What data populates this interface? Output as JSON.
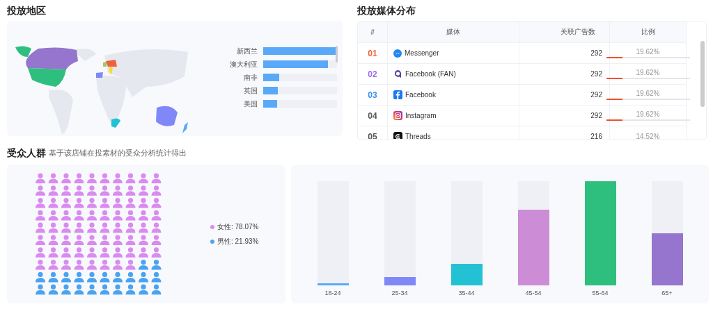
{
  "region": {
    "title": "投放地区",
    "ranking": [
      {
        "label": "新西兰",
        "level": 1
      },
      {
        "label": "澳大利亚",
        "level": 0.88
      },
      {
        "label": "南非",
        "level": 0.22
      },
      {
        "label": "英国",
        "level": 0.2
      },
      {
        "label": "美国",
        "level": 0.19
      }
    ]
  },
  "media": {
    "title": "投放媒体分布",
    "columns": [
      "#",
      "媒体",
      "关联广告数",
      "比例"
    ],
    "rows": [
      {
        "rank": "01",
        "color": "#f0603a",
        "kind": "messenger",
        "name": "Messenger",
        "ads": "292",
        "ratio": "19.62%",
        "level": 0.1962
      },
      {
        "rank": "02",
        "color": "#9b6cf0",
        "kind": "fan",
        "name": "Facebook (FAN)",
        "ads": "292",
        "ratio": "19.62%",
        "level": 0.1962
      },
      {
        "rank": "03",
        "color": "#3b8ff0",
        "kind": "facebook",
        "name": "Facebook",
        "ads": "292",
        "ratio": "19.62%",
        "level": 0.1962
      },
      {
        "rank": "04",
        "color": "#555555",
        "kind": "instagram",
        "name": "Instagram",
        "ads": "292",
        "ratio": "19.62%",
        "level": 0.1962
      },
      {
        "rank": "05",
        "color": "#555555",
        "kind": "threads",
        "name": "Threads",
        "ads": "216",
        "ratio": "14.52%"
      }
    ]
  },
  "audience": {
    "title": "受众人群",
    "subtitle": "基于该店铺在投素材的受众分析统计得出",
    "gender": [
      {
        "label": "女性: 78.07%",
        "color": "#d98bf0"
      },
      {
        "label": "男性: 21.93%",
        "color": "#4aa3f0"
      }
    ],
    "age": [
      {
        "label": "18-24",
        "color": "#5aa9f8",
        "level": 0.02
      },
      {
        "label": "25-34",
        "color": "#8088f8",
        "level": 0.08
      },
      {
        "label": "35-44",
        "color": "#22c2d4",
        "level": 0.21
      },
      {
        "label": "45-54",
        "color": "#cc8dd6",
        "level": 0.73
      },
      {
        "label": "55-64",
        "color": "#2ebf7e",
        "level": 1
      },
      {
        "label": "65+",
        "color": "#9575cd",
        "level": 0.5
      }
    ]
  }
}
